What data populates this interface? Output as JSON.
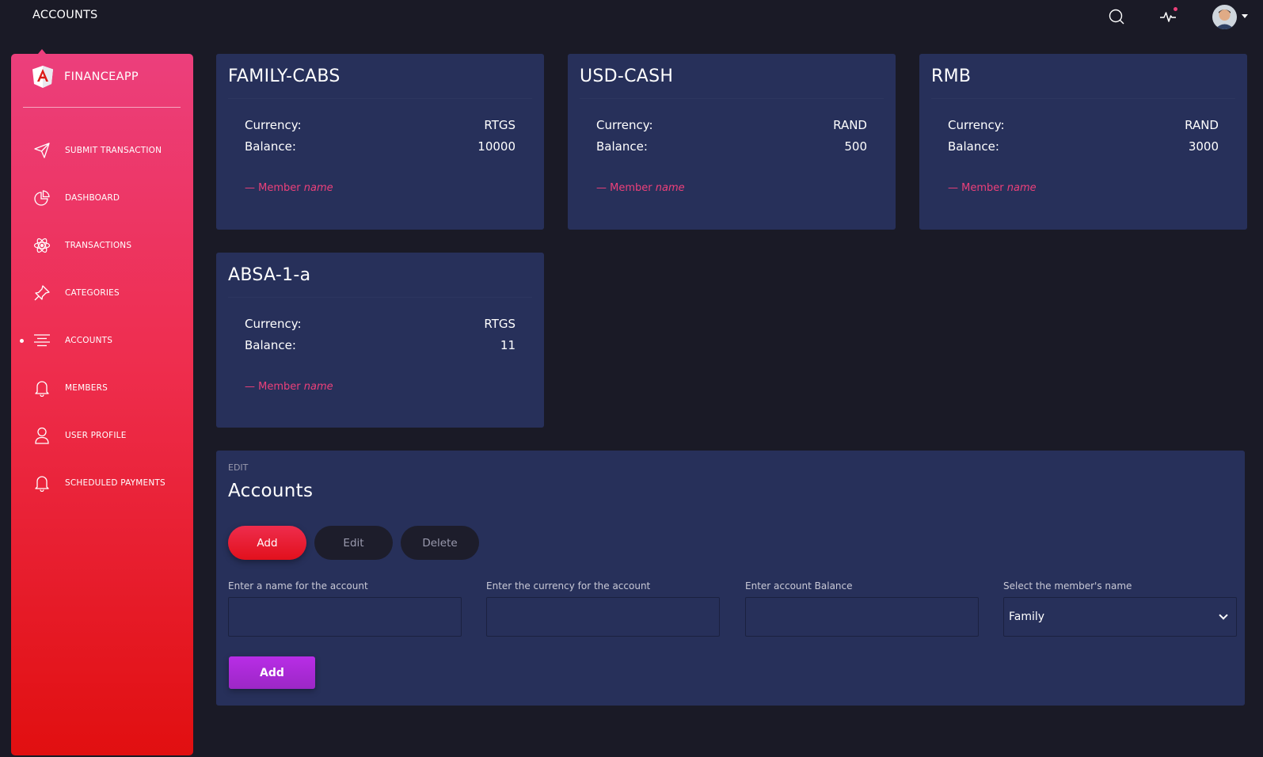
{
  "header": {
    "title": "ACCOUNTS",
    "icons": [
      "search-icon",
      "activity-icon",
      "avatar",
      "chevron-down-icon"
    ]
  },
  "sidebar": {
    "brand": "FINANCEAPP",
    "logo_icon": "angular-logo",
    "items": [
      {
        "label": "SUBMIT TRANSACTION",
        "icon": "send-icon",
        "active": false
      },
      {
        "label": "DASHBOARD",
        "icon": "pie-chart-icon",
        "active": false
      },
      {
        "label": "TRANSACTIONS",
        "icon": "atom-icon",
        "active": false
      },
      {
        "label": "CATEGORIES",
        "icon": "pin-icon",
        "active": false
      },
      {
        "label": "ACCOUNTS",
        "icon": "align-center-icon",
        "active": true
      },
      {
        "label": "MEMBERS",
        "icon": "bell-icon",
        "active": false
      },
      {
        "label": "USER PROFILE",
        "icon": "user-icon",
        "active": false
      },
      {
        "label": "SCHEDULED PAYMENTS",
        "icon": "bell-icon",
        "active": false
      }
    ]
  },
  "accounts": [
    {
      "name": "FAMILY-CABS",
      "currency_label": "Currency:",
      "currency": "RTGS",
      "balance_label": "Balance:",
      "balance": "10000",
      "member_prefix": "Member",
      "member_name": "name"
    },
    {
      "name": "USD-CASH",
      "currency_label": "Currency:",
      "currency": "RAND",
      "balance_label": "Balance:",
      "balance": "500",
      "member_prefix": "Member",
      "member_name": "name"
    },
    {
      "name": "RMB",
      "currency_label": "Currency:",
      "currency": "RAND",
      "balance_label": "Balance:",
      "balance": "3000",
      "member_prefix": "Member",
      "member_name": "name"
    },
    {
      "name": "ABSA-1-a",
      "currency_label": "Currency:",
      "currency": "RTGS",
      "balance_label": "Balance:",
      "balance": "11",
      "member_prefix": "Member",
      "member_name": "name"
    }
  ],
  "edit_panel": {
    "category": "EDIT",
    "title": "Accounts",
    "tabs": {
      "add": "Add",
      "edit": "Edit",
      "delete": "Delete"
    },
    "fields": {
      "name_label": "Enter a name for the account",
      "currency_label": "Enter the currency for the account",
      "balance_label": "Enter account Balance",
      "member_label": "Select the member's name",
      "member_selected": "Family"
    },
    "submit_label": "Add"
  },
  "colors": {
    "background": "#1a1a26",
    "card": "#27305a",
    "accent_pink": "#ec407a",
    "sidebar_top": "#ec3f7c",
    "sidebar_bottom": "#e10f10",
    "submit_purple": "#b82de6"
  }
}
